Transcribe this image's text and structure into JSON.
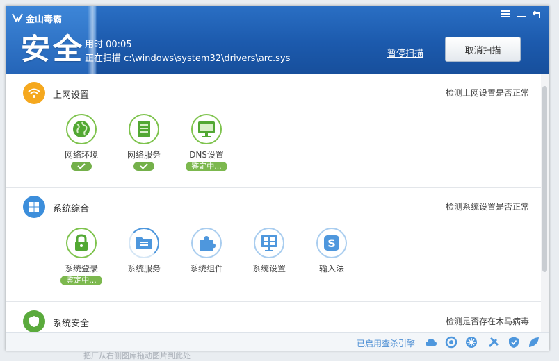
{
  "app": {
    "logo_text": "金山毒霸"
  },
  "header": {
    "status": "安全",
    "time_label": "用时 00:05",
    "scanning_label": "正在扫描 c:\\windows\\system32\\drivers\\arc.sys",
    "pause_label": "暂停扫描",
    "cancel_label": "取消扫描"
  },
  "window_controls": {
    "menu": "☰",
    "minimize": "—",
    "back": "↰"
  },
  "sections": [
    {
      "title": "上网设置",
      "description": "检测上网设置是否正常",
      "icon": "wifi-icon",
      "color": "#f5a81e",
      "items": [
        {
          "label": "网络环境",
          "icon": "globe-icon",
          "status": "ok"
        },
        {
          "label": "网络服务",
          "icon": "server-icon",
          "status": "ok"
        },
        {
          "label": "DNS设置",
          "icon": "monitor-icon",
          "status": "鉴定中..."
        }
      ]
    },
    {
      "title": "系统综合",
      "description": "检测系统设置是否正常",
      "icon": "windows-icon",
      "color": "#3c8edb",
      "items": [
        {
          "label": "系统登录",
          "icon": "lock-icon",
          "status": "鉴定中..."
        },
        {
          "label": "系统服务",
          "icon": "service-icon",
          "status": ""
        },
        {
          "label": "系统组件",
          "icon": "puzzle-icon",
          "status": ""
        },
        {
          "label": "系统设置",
          "icon": "settings-monitor-icon",
          "status": ""
        },
        {
          "label": "输入法",
          "icon": "input-method-icon",
          "status": ""
        }
      ]
    },
    {
      "title": "系统安全",
      "description": "检测是否存在木马病毒",
      "icon": "shield-icon",
      "color": "#5aaa3c"
    }
  ],
  "footer": {
    "engine_label": "已启用查杀引擎",
    "tools": [
      "cloud-icon",
      "engine-icon",
      "snowflake-icon",
      "tools-icon",
      "shield-small-icon",
      "leaf-icon"
    ]
  },
  "below_window_text": "把厂从右侧图库拖动图片到此处"
}
